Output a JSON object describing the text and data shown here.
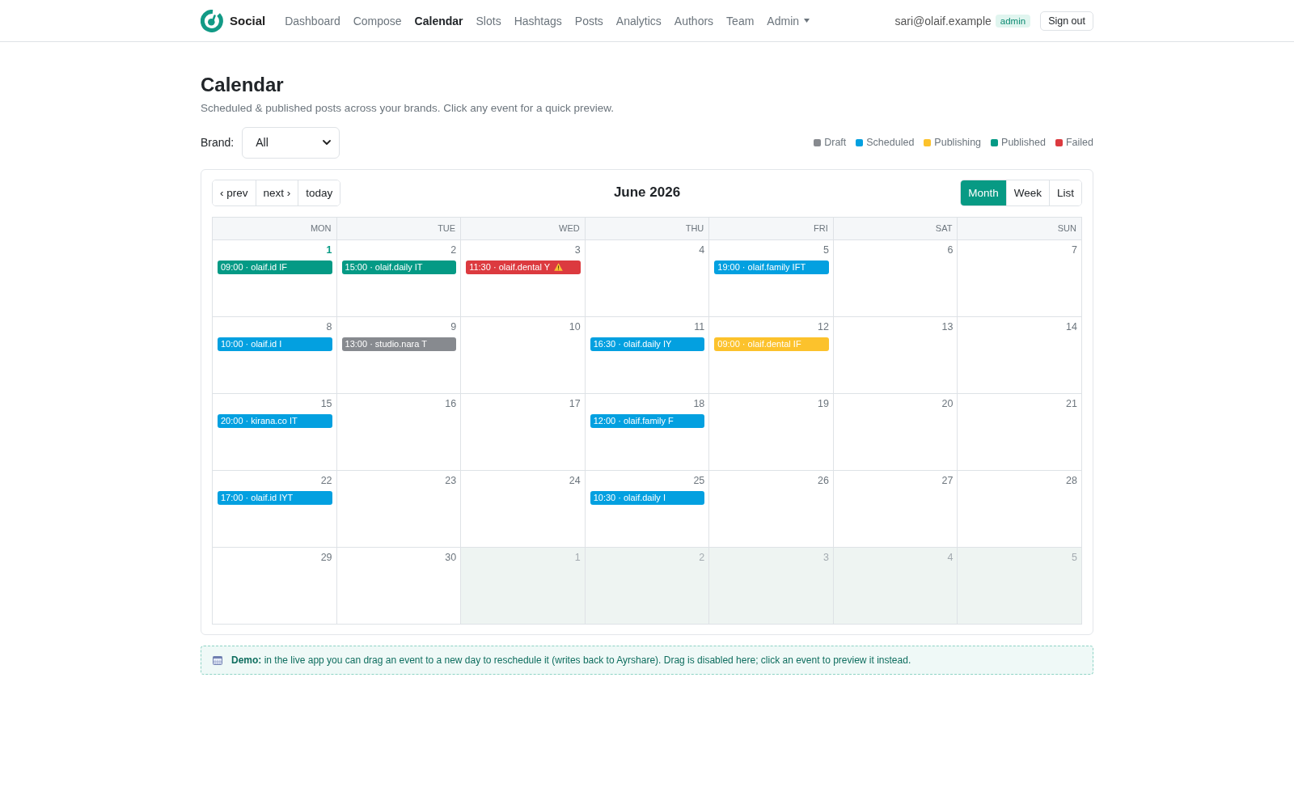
{
  "header": {
    "brand": "Social",
    "nav": [
      {
        "label": "Dashboard",
        "selected": false,
        "dropdown": false
      },
      {
        "label": "Compose",
        "selected": false,
        "dropdown": false
      },
      {
        "label": "Calendar",
        "selected": true,
        "dropdown": false
      },
      {
        "label": "Slots",
        "selected": false,
        "dropdown": false
      },
      {
        "label": "Hashtags",
        "selected": false,
        "dropdown": false
      },
      {
        "label": "Posts",
        "selected": false,
        "dropdown": false
      },
      {
        "label": "Analytics",
        "selected": false,
        "dropdown": false
      },
      {
        "label": "Authors",
        "selected": false,
        "dropdown": false
      },
      {
        "label": "Team",
        "selected": false,
        "dropdown": false
      },
      {
        "label": "Admin",
        "selected": false,
        "dropdown": true
      }
    ],
    "user": {
      "email": "sari@olaif.example",
      "role": "admin"
    },
    "sign_out": "Sign out"
  },
  "page": {
    "title": "Calendar",
    "subtitle": "Scheduled & published posts across your brands. Click any event for a quick preview."
  },
  "filter": {
    "label": "Brand:",
    "value": "All"
  },
  "legend": [
    {
      "label": "Draft",
      "color": "#878a8f"
    },
    {
      "label": "Scheduled",
      "color": "#03a0e0"
    },
    {
      "label": "Publishing",
      "color": "#fcc22c"
    },
    {
      "label": "Published",
      "color": "#049a85"
    },
    {
      "label": "Failed",
      "color": "#dc3a3f"
    }
  ],
  "calendar": {
    "nav_buttons": [
      "‹ prev",
      "next ›",
      "today"
    ],
    "title": "June 2026",
    "views": [
      {
        "label": "Month",
        "selected": true
      },
      {
        "label": "Week",
        "selected": false
      },
      {
        "label": "List",
        "selected": false
      }
    ],
    "weekdays": [
      "MON",
      "TUE",
      "WED",
      "THU",
      "FRI",
      "SAT",
      "SUN"
    ],
    "weeks": [
      {
        "days": [
          {
            "day": "1",
            "today": true,
            "outside_month": false,
            "events": [
              {
                "text": "09:00 · olaif.id IF",
                "color": "#049a85",
                "warning": false
              }
            ]
          },
          {
            "day": "2",
            "today": false,
            "outside_month": false,
            "events": [
              {
                "text": "15:00 · olaif.daily IT",
                "color": "#049a85",
                "warning": false
              }
            ]
          },
          {
            "day": "3",
            "today": false,
            "outside_month": false,
            "events": [
              {
                "text": "11:30 · olaif.dental Y",
                "color": "#dc3a3f",
                "warning": true
              }
            ]
          },
          {
            "day": "4",
            "today": false,
            "outside_month": false
          },
          {
            "day": "5",
            "today": false,
            "outside_month": false,
            "events": [
              {
                "text": "19:00 · olaif.family IFT",
                "color": "#03a0e0",
                "warning": false
              }
            ]
          },
          {
            "day": "6",
            "today": false,
            "outside_month": false
          },
          {
            "day": "7",
            "today": false,
            "outside_month": false
          }
        ]
      },
      {
        "days": [
          {
            "day": "8",
            "today": false,
            "outside_month": false,
            "events": [
              {
                "text": "10:00 · olaif.id I",
                "color": "#03a0e0",
                "warning": false
              }
            ]
          },
          {
            "day": "9",
            "today": false,
            "outside_month": false,
            "events": [
              {
                "text": "13:00 · studio.nara T",
                "color": "#878a8f",
                "warning": false
              }
            ]
          },
          {
            "day": "10",
            "today": false,
            "outside_month": false
          },
          {
            "day": "11",
            "today": false,
            "outside_month": false,
            "events": [
              {
                "text": "16:30 · olaif.daily IY",
                "color": "#03a0e0",
                "warning": false
              }
            ]
          },
          {
            "day": "12",
            "today": false,
            "outside_month": false,
            "events": [
              {
                "text": "09:00 · olaif.dental IF",
                "color": "#fcc22c",
                "warning": false
              }
            ]
          },
          {
            "day": "13",
            "today": false,
            "outside_month": false
          },
          {
            "day": "14",
            "today": false,
            "outside_month": false
          }
        ]
      },
      {
        "days": [
          {
            "day": "15",
            "today": false,
            "outside_month": false,
            "events": [
              {
                "text": "20:00 · kirana.co IT",
                "color": "#03a0e0",
                "warning": false
              }
            ]
          },
          {
            "day": "16",
            "today": false,
            "outside_month": false
          },
          {
            "day": "17",
            "today": false,
            "outside_month": false
          },
          {
            "day": "18",
            "today": false,
            "outside_month": false,
            "events": [
              {
                "text": "12:00 · olaif.family F",
                "color": "#03a0e0",
                "warning": false
              }
            ]
          },
          {
            "day": "19",
            "today": false,
            "outside_month": false
          },
          {
            "day": "20",
            "today": false,
            "outside_month": false
          },
          {
            "day": "21",
            "today": false,
            "outside_month": false
          }
        ]
      },
      {
        "days": [
          {
            "day": "22",
            "today": false,
            "outside_month": false,
            "events": [
              {
                "text": "17:00 · olaif.id IYT",
                "color": "#03a0e0",
                "warning": false
              }
            ]
          },
          {
            "day": "23",
            "today": false,
            "outside_month": false
          },
          {
            "day": "24",
            "today": false,
            "outside_month": false
          },
          {
            "day": "25",
            "today": false,
            "outside_month": false,
            "events": [
              {
                "text": "10:30 · olaif.daily I",
                "color": "#03a0e0",
                "warning": false
              }
            ]
          },
          {
            "day": "26",
            "today": false,
            "outside_month": false
          },
          {
            "day": "27",
            "today": false,
            "outside_month": false
          },
          {
            "day": "28",
            "today": false,
            "outside_month": false
          }
        ]
      },
      {
        "days": [
          {
            "day": "29",
            "today": false,
            "outside_month": false
          },
          {
            "day": "30",
            "today": false,
            "outside_month": false
          },
          {
            "day": "1",
            "today": false,
            "outside_month": true
          },
          {
            "day": "2",
            "today": false,
            "outside_month": true
          },
          {
            "day": "3",
            "today": false,
            "outside_month": true
          },
          {
            "day": "4",
            "today": false,
            "outside_month": true
          },
          {
            "day": "5",
            "today": false,
            "outside_month": true
          }
        ]
      }
    ]
  },
  "notice": {
    "text": "**Demo:** in the live app you can drag an event to a new day to reschedule it (writes back to Ayrshare). Drag is disabled here; click an event to preview it instead."
  }
}
